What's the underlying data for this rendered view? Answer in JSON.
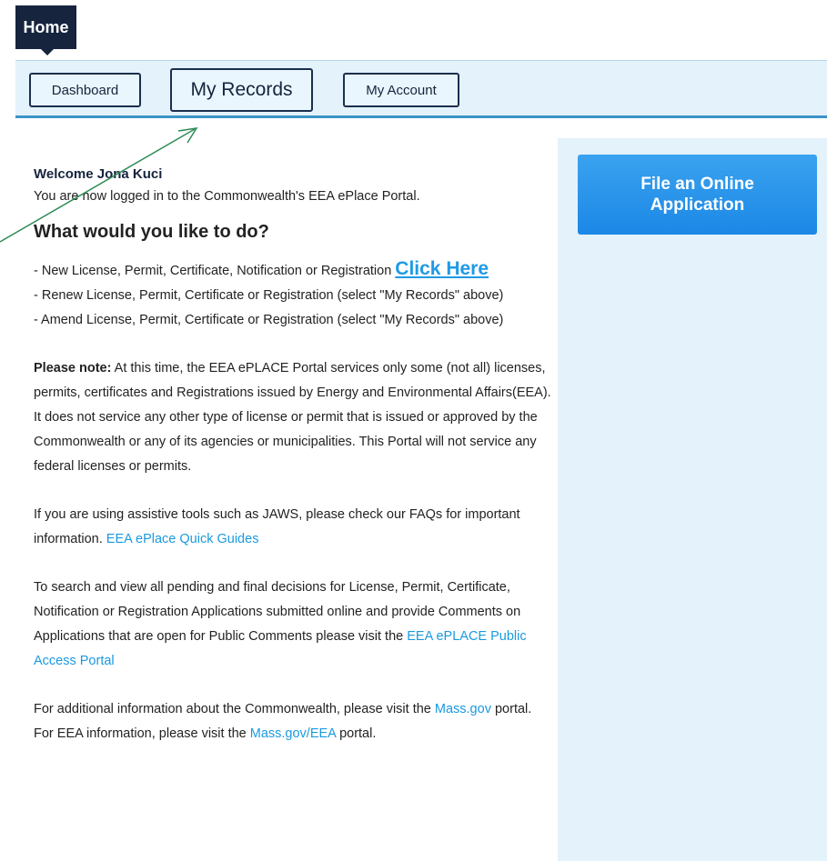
{
  "header": {
    "home_tab": "Home"
  },
  "nav": {
    "dashboard": "Dashboard",
    "my_records": "My Records",
    "my_account": "My Account"
  },
  "sidebar": {
    "file_online_application": "File an Online Application"
  },
  "main": {
    "welcome": "Welcome  Jona Kuci",
    "logged_in": "You are now logged in to the Commonwealth's EEA ePlace Portal.",
    "question": "What would you like to do?",
    "options": {
      "new_prefix": "- New License, Permit, Certificate, Notification or Registration",
      "click_here": "Click Here",
      "renew": "- Renew License, Permit, Certificate or Registration (select \"My Records\" above)",
      "amend": "- Amend License, Permit, Certificate or Registration (select \"My Records\" above)"
    },
    "note": {
      "label": "Please note:",
      "text": " At this time, the EEA ePLACE Portal services only some (not all) licenses, permits, certificates and Registrations issued by Energy and Environmental Affairs(EEA). It does not service any other type of license or permit that is issued or approved by the Commonwealth or any of its agencies or municipalities. This Portal will not service any federal licenses or permits."
    },
    "assistive": {
      "text": "If you are using assistive tools such as JAWS, please check our FAQs for important information. ",
      "link": "EEA ePlace Quick Guides"
    },
    "search": {
      "text": "To search and view all pending and final decisions for License, Permit, Certificate, Notification or Registration Applications submitted online and provide Comments on Applications that are open for Public Comments please visit the ",
      "link": "EEA ePLACE Public Access Portal"
    },
    "additional": {
      "line1_prefix": "For additional information about the Commonwealth, please visit the ",
      "line1_link": "Mass.gov",
      "line1_suffix": " portal.",
      "line2_prefix": "For EEA information, please visit the ",
      "line2_link": "Mass.gov/EEA",
      "line2_suffix": " portal."
    }
  },
  "colors": {
    "nav_bg": "#e4f2fb",
    "dark_navy": "#16243e",
    "accent_blue": "#1f9ae6",
    "annotation_arrow": "#2e8b57"
  }
}
